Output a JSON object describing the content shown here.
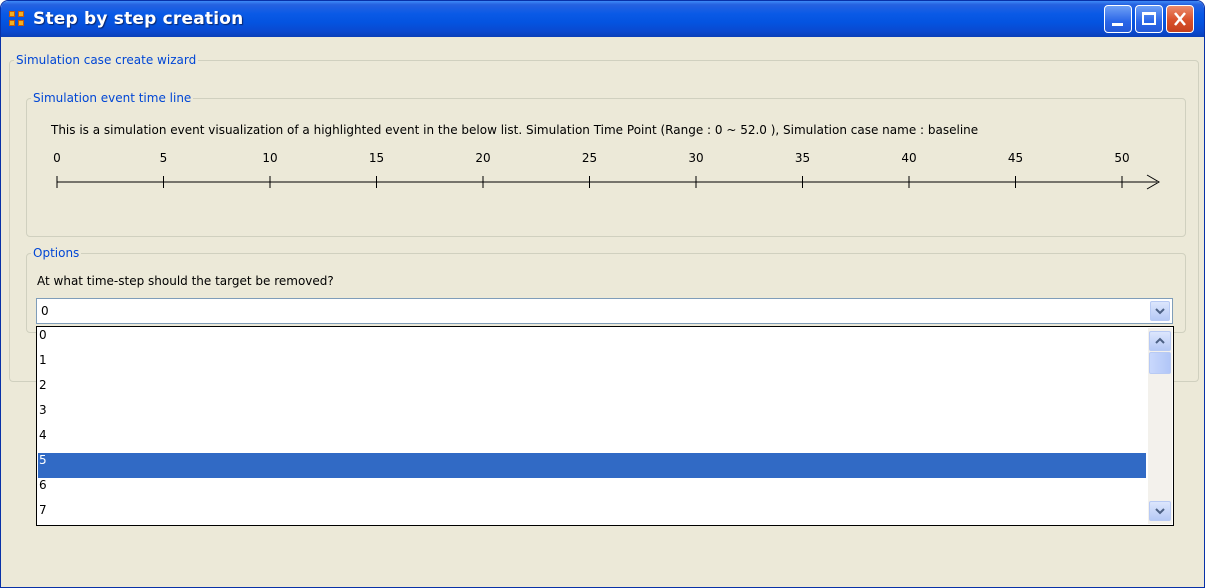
{
  "window": {
    "title": "Step by step creation"
  },
  "wizard": {
    "legend": "Simulation case create wizard"
  },
  "timeline": {
    "legend": "Simulation event time line",
    "description": "This is a simulation event visualization of a highlighted event in the below list. Simulation Time Point (Range : 0 ~ 52.0 ), Simulation case name : baseline",
    "ticks": [
      "0",
      "5",
      "10",
      "15",
      "20",
      "25",
      "30",
      "35",
      "40",
      "45",
      "50"
    ]
  },
  "options": {
    "legend": "Options",
    "question": "At what time-step should the target be removed?",
    "selected_value": "0",
    "list_items": [
      "0",
      "1",
      "2",
      "3",
      "4",
      "5",
      "6",
      "7"
    ],
    "highlighted_item": "5"
  },
  "colors": {
    "title_bar": "#0A5AE6",
    "group_legend": "#0046D5",
    "selection": "#316AC5",
    "window_background": "#ECE9D8"
  }
}
